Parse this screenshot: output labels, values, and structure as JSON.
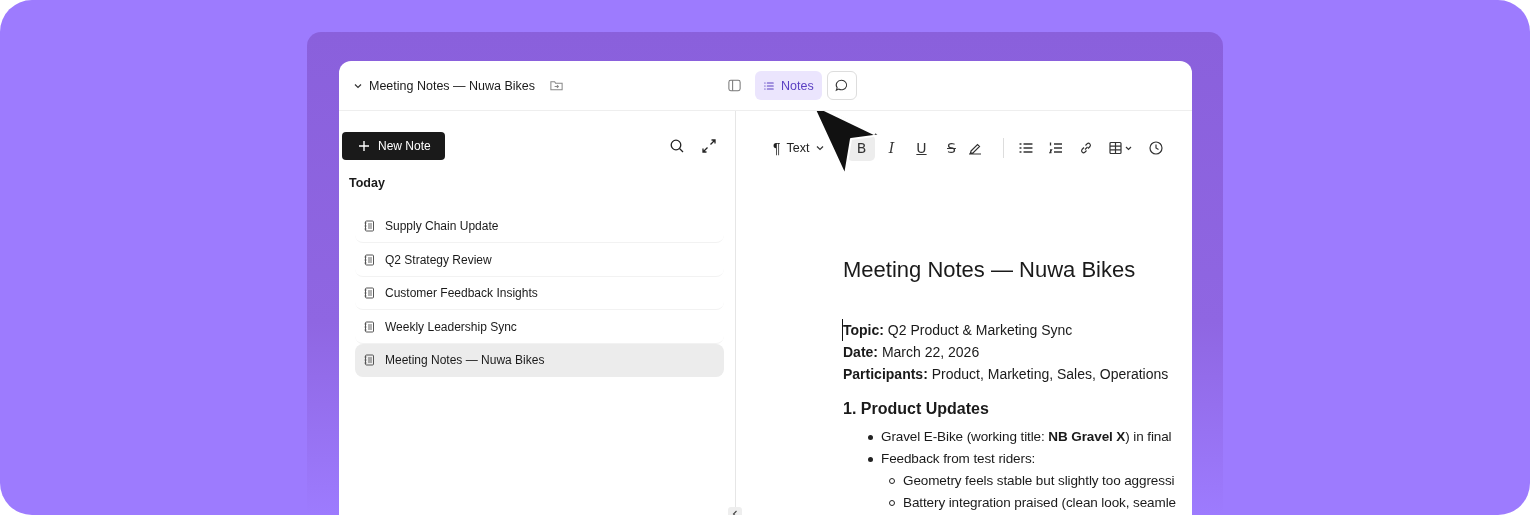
{
  "header": {
    "title": "Meeting Notes — Nuwa Bikes",
    "views": [
      {
        "kind": "notes",
        "label": "Notes",
        "selected": true
      },
      {
        "kind": "chat",
        "selected": false
      }
    ]
  },
  "sidebar": {
    "new_button": "New Note",
    "section": "Today",
    "notes": [
      {
        "title": "Supply Chain Update",
        "selected": false
      },
      {
        "title": "Q2 Strategy Review",
        "selected": false
      },
      {
        "title": "Customer Feedback Insights",
        "selected": false
      },
      {
        "title": "Weekly Leadership Sync",
        "selected": false
      },
      {
        "title": "Meeting Notes — Nuwa Bikes",
        "selected": true
      }
    ]
  },
  "toolbar": {
    "block_glyph": "¶",
    "block_type": "Text",
    "format_buttons": [
      {
        "kind": "bold",
        "glyph": "B",
        "active": true
      },
      {
        "kind": "italic",
        "glyph": "I",
        "active": false
      },
      {
        "kind": "underline",
        "glyph": "U",
        "active": false
      },
      {
        "kind": "strike",
        "glyph": "S",
        "active": false
      }
    ]
  },
  "document": {
    "title": "Meeting Notes — Nuwa Bikes",
    "meta": [
      "**Topic:** Q2 Product & Marketing Sync",
      "**Date:** March 22, 2026",
      "**Participants:** Product, Marketing, Sales, Operations"
    ],
    "heading": "1. Product Updates",
    "bullets": [
      {
        "text": "Gravel E-Bike (working title: **NB Gravel X**) in final"
      },
      {
        "text": "Feedback from test riders:",
        "children": [
          {
            "text": "Geometry feels stable but slightly too aggressi"
          },
          {
            "text": "Battery integration praised (clean look, seamle"
          }
        ]
      }
    ]
  }
}
